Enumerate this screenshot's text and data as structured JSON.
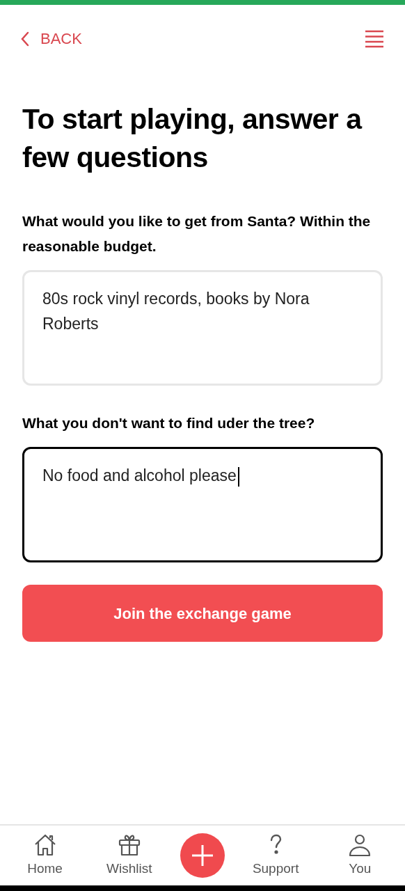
{
  "header": {
    "back_label": "BACK"
  },
  "title": "To start playing, answer a few questions",
  "questions": [
    {
      "label": "What would you like to get from Santa? Within the reasonable budget.",
      "value": "80s rock vinyl records, books by Nora Roberts",
      "focused": false
    },
    {
      "label": "What you don't want to find uder the tree?",
      "value": "No food and alcohol please",
      "focused": true
    }
  ],
  "submit_button": "Join the exchange game",
  "nav": [
    {
      "kind": "home",
      "label": "Home"
    },
    {
      "kind": "wishlist",
      "label": "Wishlist"
    },
    {
      "kind": "add"
    },
    {
      "kind": "support",
      "label": "Support"
    },
    {
      "kind": "you",
      "label": "You"
    }
  ]
}
